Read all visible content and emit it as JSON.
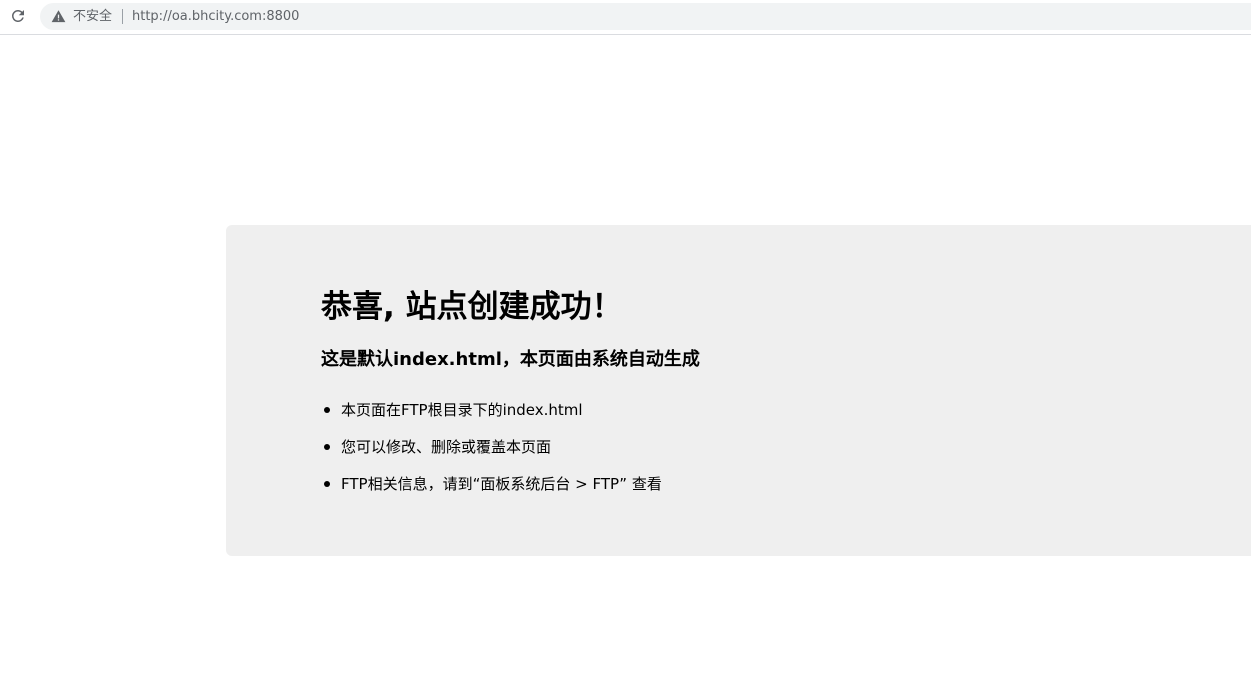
{
  "browser": {
    "security_label": "不安全",
    "url": "http://oa.bhcity.com:8800"
  },
  "content": {
    "title": "恭喜, 站点创建成功！",
    "subtitle": "这是默认index.html，本页面由系统自动生成",
    "items": [
      "本页面在FTP根目录下的index.html",
      "您可以修改、删除或覆盖本页面",
      "FTP相关信息，请到“面板系统后台 > FTP” 查看"
    ]
  }
}
